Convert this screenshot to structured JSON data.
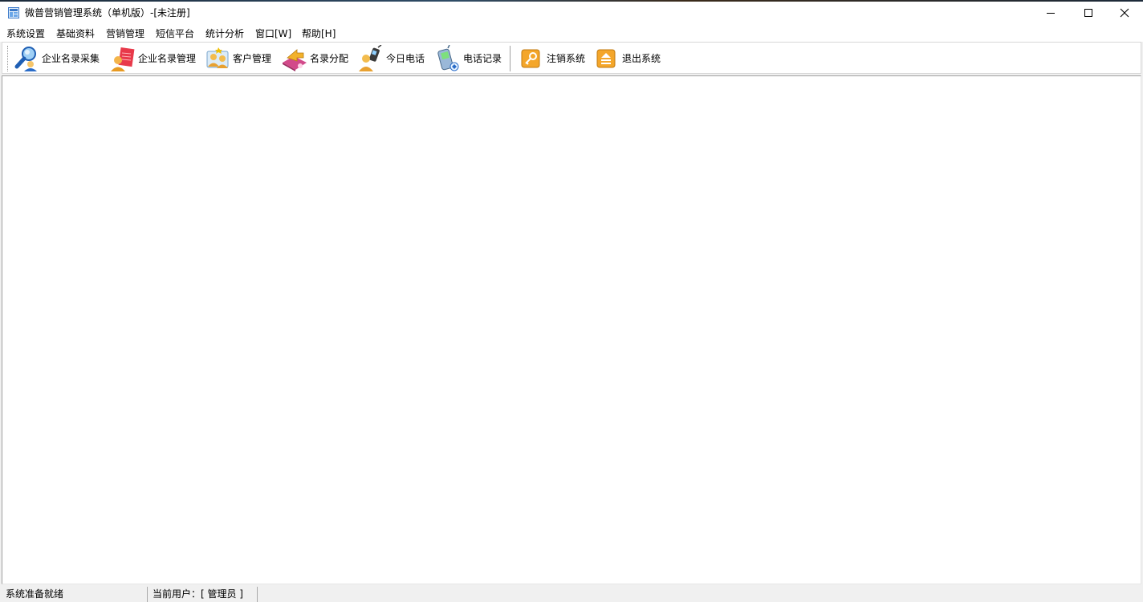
{
  "window": {
    "title": "微普营销管理系统（单机版）-[未注册]",
    "controls": [
      "minimize-icon",
      "maximize-icon",
      "close-icon"
    ]
  },
  "menu": {
    "items": [
      {
        "label": "系统设置"
      },
      {
        "label": "基础资料"
      },
      {
        "label": "营销管理"
      },
      {
        "label": "短信平台"
      },
      {
        "label": "统计分析"
      },
      {
        "label": "窗口[W]"
      },
      {
        "label": "帮助[H]"
      }
    ]
  },
  "toolbar": {
    "buttons": [
      {
        "label": "企业名录采集",
        "icon": "search-person-icon"
      },
      {
        "label": "企业名录管理",
        "icon": "user-document-icon"
      },
      {
        "label": "客户管理",
        "icon": "customer-group-icon"
      },
      {
        "label": "名录分配",
        "icon": "distribute-arrow-icon"
      },
      {
        "label": "今日电话",
        "icon": "phone-user-icon"
      },
      {
        "label": "电话记录",
        "icon": "mobile-phone-icon"
      },
      {
        "label": "注销系统",
        "icon": "key-icon"
      },
      {
        "label": "退出系统",
        "icon": "exit-icon"
      }
    ]
  },
  "status": {
    "message": "系统准备就绪",
    "current_user": "当前用户：[ 管理员 ]"
  },
  "colors": {
    "window_bg": "#f0f0f0",
    "client_bg": "#ffffff",
    "icon_orange": "#f0a020",
    "icon_blue": "#2a6cc8"
  }
}
